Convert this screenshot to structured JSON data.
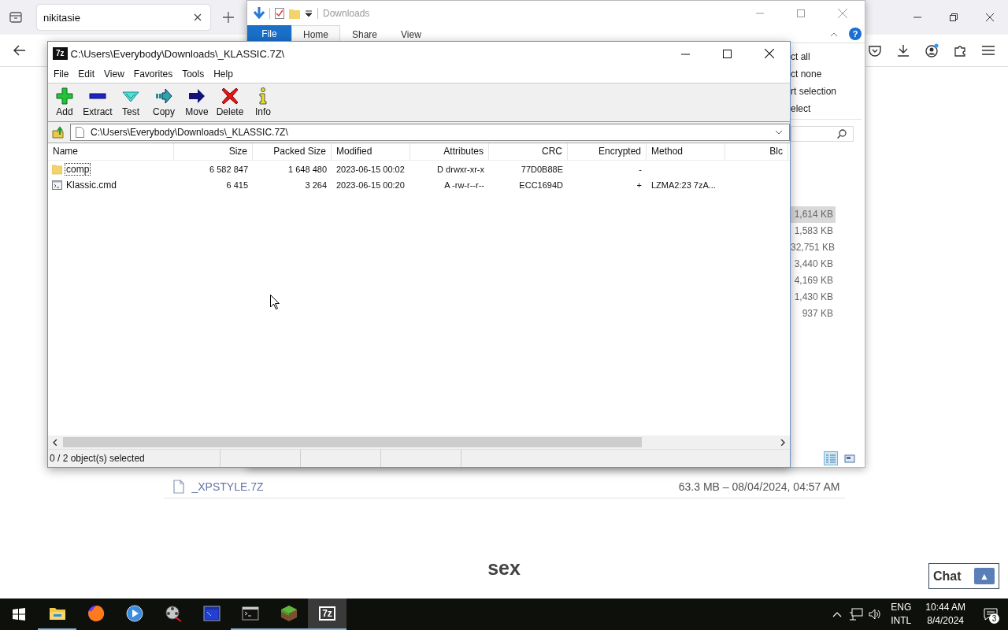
{
  "browser": {
    "tab": {
      "title": "nikitasie"
    },
    "download": {
      "name": "_XPSTYLE.7Z",
      "meta": "63.3 MB – 08/04/2024, 04:57 AM"
    },
    "heading": "sex",
    "chat": {
      "label": "Chat",
      "icon": "▲"
    }
  },
  "explorer": {
    "title": "Downloads",
    "file_tab": "File",
    "help": "?",
    "ribbon_tabs": [
      {
        "label": "Home",
        "selected": true
      },
      {
        "label": "Share",
        "selected": false
      },
      {
        "label": "View",
        "selected": false
      }
    ],
    "select_commands": [
      "ct all",
      "ct none",
      "rt selection",
      "elect"
    ],
    "sizes": [
      {
        "text": "1,614 KB",
        "selected": true
      },
      {
        "text": "1,583 KB",
        "selected": false
      },
      {
        "text": "32,751 KB",
        "selected": false
      },
      {
        "text": "3,440 KB",
        "selected": false
      },
      {
        "text": "4,169 KB",
        "selected": false
      },
      {
        "text": "1,430 KB",
        "selected": false
      },
      {
        "text": "937 KB",
        "selected": false
      }
    ],
    "views": [
      {
        "kind": "details",
        "selected": true
      },
      {
        "kind": "large_icons",
        "selected": false
      }
    ]
  },
  "sevenzip": {
    "logo": "7z",
    "title": "C:\\Users\\Everybody\\Downloads\\_KLASSIC.7Z\\",
    "menu": [
      "File",
      "Edit",
      "View",
      "Favorites",
      "Tools",
      "Help"
    ],
    "toolbar": [
      {
        "label": "Add",
        "kind": "add"
      },
      {
        "label": "Extract",
        "kind": "extract"
      },
      {
        "label": "Test",
        "kind": "test"
      },
      {
        "label": "Copy",
        "kind": "copy"
      },
      {
        "label": "Move",
        "kind": "move"
      },
      {
        "label": "Delete",
        "kind": "delete"
      },
      {
        "label": "Info",
        "kind": "info"
      }
    ],
    "address": "C:\\Users\\Everybody\\Downloads\\_KLASSIC.7Z\\",
    "columns": [
      "Name",
      "Size",
      "Packed Size",
      "Modified",
      "Attributes",
      "CRC",
      "Encrypted",
      "Method",
      "Blc"
    ],
    "rows": [
      {
        "kind": "folder",
        "focused": true,
        "cells": [
          "comp",
          "6 582 847",
          "1 648 480",
          "2023-06-15 00:02",
          "D drwxr-xr-x",
          "77D0B88E",
          "-"
        ]
      },
      {
        "kind": "file",
        "focused": false,
        "cells": [
          "Klassic.cmd",
          "6 415",
          "3 264",
          "2023-06-15 00:20",
          "A -rw-r--r--",
          "ECC1694D",
          "+",
          "LZMA2:23 7zA..."
        ]
      }
    ],
    "status": "0 / 2 object(s) selected"
  },
  "taskbar": {
    "apps": [
      {
        "kind": "explorer",
        "running": true,
        "active": false
      },
      {
        "kind": "browser",
        "running": false,
        "active": false
      },
      {
        "kind": "player",
        "running": false,
        "active": false
      },
      {
        "kind": "reel",
        "running": false,
        "active": false
      },
      {
        "kind": "window",
        "running": false,
        "active": false
      },
      {
        "kind": "terminal",
        "running": true,
        "active": false
      },
      {
        "kind": "cube",
        "running": true,
        "active": false
      },
      {
        "kind": "archiver",
        "running": true,
        "active": true,
        "label": "7z"
      }
    ],
    "lang": "ENG",
    "layout": "INTL",
    "time": "10:44 AM",
    "date": "8/4/2024",
    "notifications": "3"
  }
}
